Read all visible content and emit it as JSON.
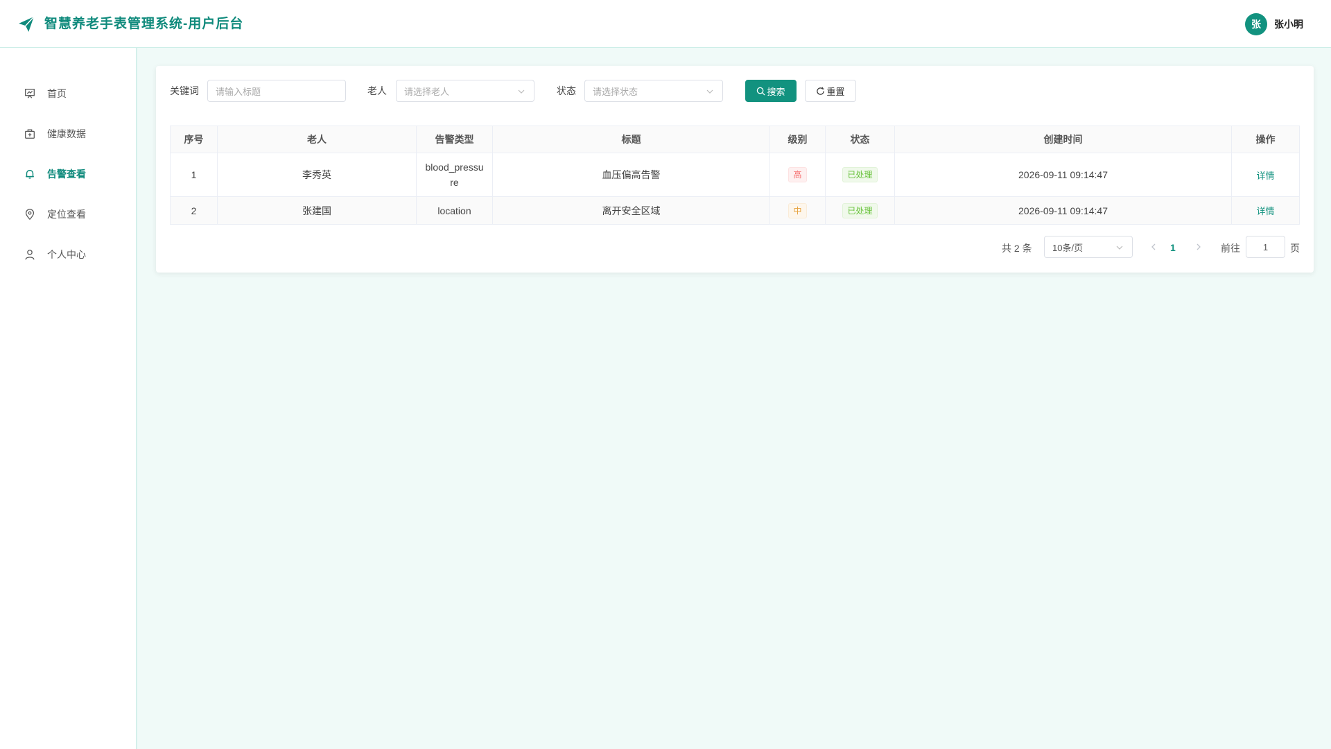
{
  "header": {
    "title": "智慧养老手表管理系统-用户后台",
    "avatar_text": "张",
    "username": "张小明",
    "logo_icon": "paper-plane-icon"
  },
  "sidebar": {
    "items": [
      {
        "label": "首页",
        "icon": "dashboard-icon",
        "active": false
      },
      {
        "label": "健康数据",
        "icon": "medical-kit-icon",
        "active": false
      },
      {
        "label": "告警查看",
        "icon": "bell-icon",
        "active": true
      },
      {
        "label": "定位查看",
        "icon": "location-pin-icon",
        "active": false
      },
      {
        "label": "个人中心",
        "icon": "user-icon",
        "active": false
      }
    ]
  },
  "filters": {
    "keyword_label": "关键词",
    "keyword_placeholder": "请输入标题",
    "elder_label": "老人",
    "elder_placeholder": "请选择老人",
    "status_label": "状态",
    "status_placeholder": "请选择状态",
    "search_button": "搜索",
    "reset_button": "重置"
  },
  "table": {
    "columns": [
      "序号",
      "老人",
      "告警类型",
      "标题",
      "级别",
      "状态",
      "创建时间",
      "操作"
    ],
    "rows": [
      {
        "index": "1",
        "elder": "李秀英",
        "type": "blood_pressure",
        "title": "血压偏高告警",
        "level": "高",
        "status": "已处理",
        "created": "2026-09-11 09:14:47",
        "action": "详情"
      },
      {
        "index": "2",
        "elder": "张建国",
        "type": "location",
        "title": "离开安全区域",
        "level": "中",
        "status": "已处理",
        "created": "2026-09-11 09:14:47",
        "action": "详情"
      }
    ]
  },
  "pagination": {
    "total": "共 2 条",
    "page_size": "10条/页",
    "current_page": "1",
    "goto_label": "前往",
    "goto_value": "1",
    "page_suffix": "页"
  },
  "colors": {
    "accent": "#12927f",
    "background": "#f0faf8",
    "level_high": "#f56c6c",
    "level_mid": "#e6a23c",
    "status_done": "#67c23a"
  }
}
